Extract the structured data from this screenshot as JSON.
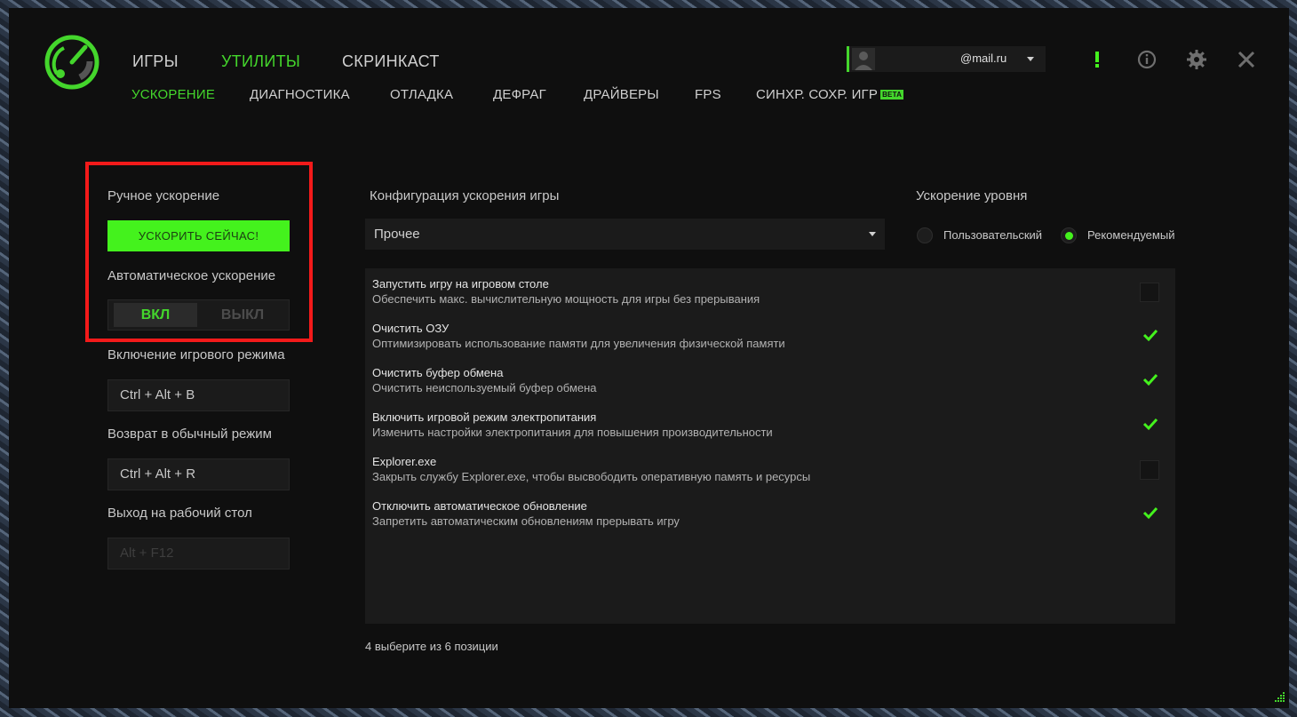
{
  "header": {
    "main_tabs": [
      {
        "label": "ИГРЫ"
      },
      {
        "label": "УТИЛИТЫ"
      },
      {
        "label": "СКРИНКАСТ"
      }
    ],
    "active_main_tab": "УТИЛИТЫ",
    "sub_tabs": [
      {
        "label": "УСКОРЕНИЕ"
      },
      {
        "label": "ДИАГНОСТИКА"
      },
      {
        "label": "ОТЛАДКА"
      },
      {
        "label": "ДЕФРАГ"
      },
      {
        "label": "ДРАЙВЕРЫ"
      },
      {
        "label": "FPS"
      },
      {
        "label": "СИНХР. СОХР. ИГР"
      }
    ],
    "active_sub_tab": "УСКОРЕНИЕ",
    "beta_badge": "BETA",
    "user": {
      "email": "@mail.ru"
    },
    "icons": [
      "alert-icon",
      "info-icon",
      "settings-icon",
      "close-icon"
    ]
  },
  "left_panel": {
    "manual_label": "Ручное ускорение",
    "boost_button": "УСКОРИТЬ СЕЙЧАС!",
    "auto_label": "Автоматическое ускорение",
    "toggle_on": "ВКЛ",
    "toggle_off": "ВЫКЛ",
    "toggle_state": "on",
    "game_mode_label": "Включение игрового режима",
    "game_mode_hotkey": "Ctrl + Alt + B",
    "normal_mode_label": "Возврат в обычный режим",
    "normal_mode_hotkey": "Ctrl + Alt + R",
    "desktop_label": "Выход на рабочий стол",
    "desktop_hotkey": "Alt + F12"
  },
  "right_panel": {
    "config_label": "Конфигурация ускорения игры",
    "config_value": "Прочее",
    "level_label": "Ускорение уровня",
    "level_options": [
      "Пользовательский",
      "Рекомендуемый"
    ],
    "level_selected": "Рекомендуемый",
    "items": [
      {
        "title": "Запустить игру на игровом столе",
        "desc": "Обеспечить макс. вычислительную мощность для игры без прерывания",
        "checked": false
      },
      {
        "title": "Очистить ОЗУ",
        "desc": "Оптимизировать использование памяти для увеличения физической памяти",
        "checked": true
      },
      {
        "title": "Очистить буфер обмена",
        "desc": "Очистить неиспользуемый буфер обмена",
        "checked": true
      },
      {
        "title": "Включить игровой режим электропитания",
        "desc": "Изменить настройки электропитания для повышения производительности",
        "checked": true
      },
      {
        "title": "Explorer.exe",
        "desc": "Закрыть службу Explorer.exe, чтобы высвободить оперативную память и ресурсы",
        "checked": false
      },
      {
        "title": "Отключить автоматическое обновление",
        "desc": "Запретить автоматическим обновлениям прерывать игру",
        "checked": true
      }
    ],
    "footer": "4 выберите из 6 позиции"
  },
  "colors": {
    "accent": "#44d62c",
    "button": "#44f21d",
    "highlight_border": "#f31a1a",
    "window_bg": "#0f0f0f"
  }
}
